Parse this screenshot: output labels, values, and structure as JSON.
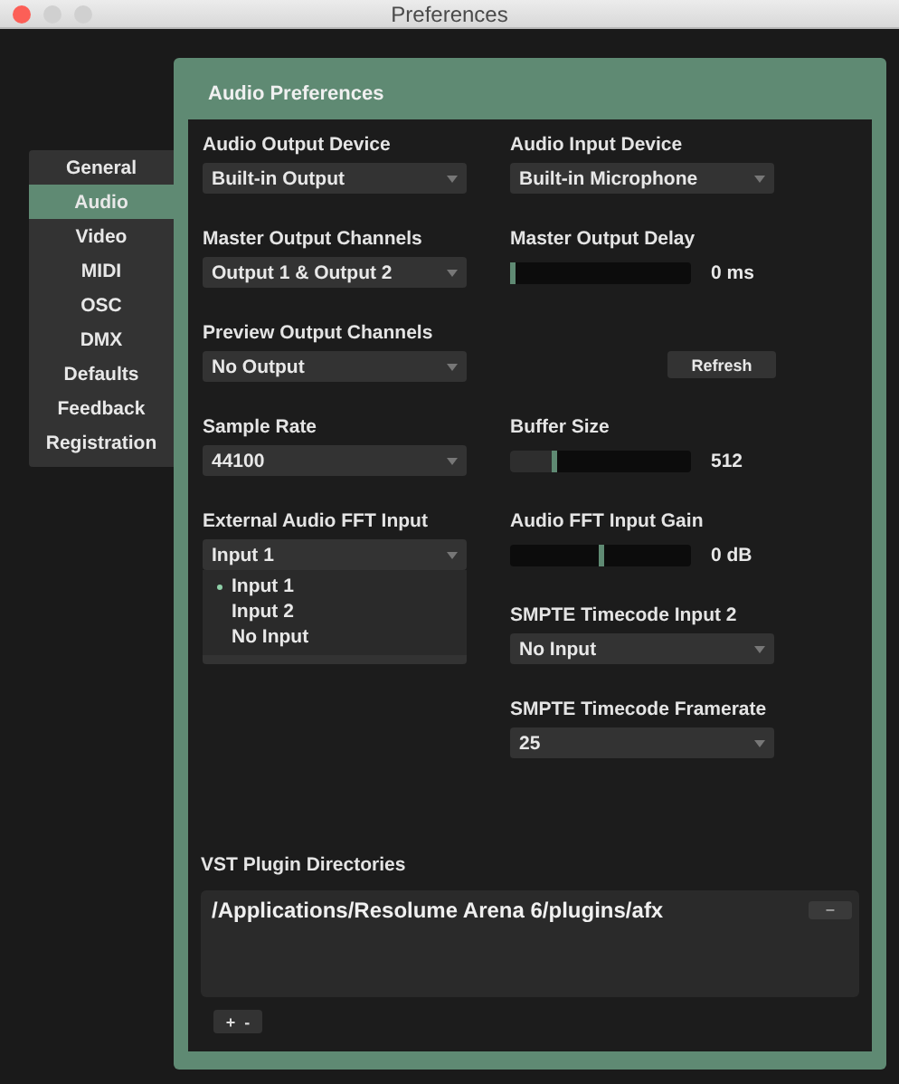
{
  "window": {
    "title": "Preferences"
  },
  "sidebar": {
    "items": [
      {
        "label": "General",
        "selected": false
      },
      {
        "label": "Audio",
        "selected": true
      },
      {
        "label": "Video",
        "selected": false
      },
      {
        "label": "MIDI",
        "selected": false
      },
      {
        "label": "OSC",
        "selected": false
      },
      {
        "label": "DMX",
        "selected": false
      },
      {
        "label": "Defaults",
        "selected": false
      },
      {
        "label": "Feedback",
        "selected": false
      },
      {
        "label": "Registration",
        "selected": false
      }
    ]
  },
  "panel": {
    "title": "Audio Preferences",
    "left_column": [
      {
        "kind": "select",
        "label": "Audio Output Device",
        "value": "Built-in Output"
      },
      {
        "kind": "select",
        "label": "Master Output Channels",
        "value": "Output 1 & Output 2"
      },
      {
        "kind": "select",
        "label": "Preview Output Channels",
        "value": "No Output"
      },
      {
        "kind": "select",
        "label": "Sample Rate",
        "value": "44100"
      },
      {
        "kind": "select",
        "label": "External Audio FFT Input",
        "value": "Input 1",
        "expanded": true,
        "options": [
          {
            "label": "Input 1",
            "selected": true
          },
          {
            "label": "Input 2",
            "selected": false
          },
          {
            "label": "No Input",
            "selected": false
          }
        ]
      },
      {
        "kind": "covered-select"
      }
    ],
    "right_column": [
      {
        "kind": "select",
        "label": "Audio Input Device",
        "value": "Built-in Microphone"
      },
      {
        "kind": "slider",
        "label": "Master Output Delay",
        "level": 0,
        "reading": "0 ms"
      },
      {
        "kind": "button",
        "label": "Refresh"
      },
      {
        "kind": "slider",
        "label": "Buffer Size",
        "level": 0.24,
        "reading": "512"
      },
      {
        "kind": "slider",
        "label": "Audio FFT Input Gain",
        "level": 0.5,
        "reading": "0 dB",
        "bipolar": true
      },
      {
        "kind": "select",
        "label": "SMPTE Timecode Input 2",
        "value": "No Input"
      },
      {
        "kind": "select",
        "label": "SMPTE Timecode Framerate",
        "value": "25"
      }
    ],
    "vst": {
      "label": "VST Plugin Directories",
      "directories": [
        {
          "path": "/Applications/Resolume Arena 6/plugins/afx",
          "remove": "–"
        }
      ],
      "add_remove": "+  -"
    }
  }
}
